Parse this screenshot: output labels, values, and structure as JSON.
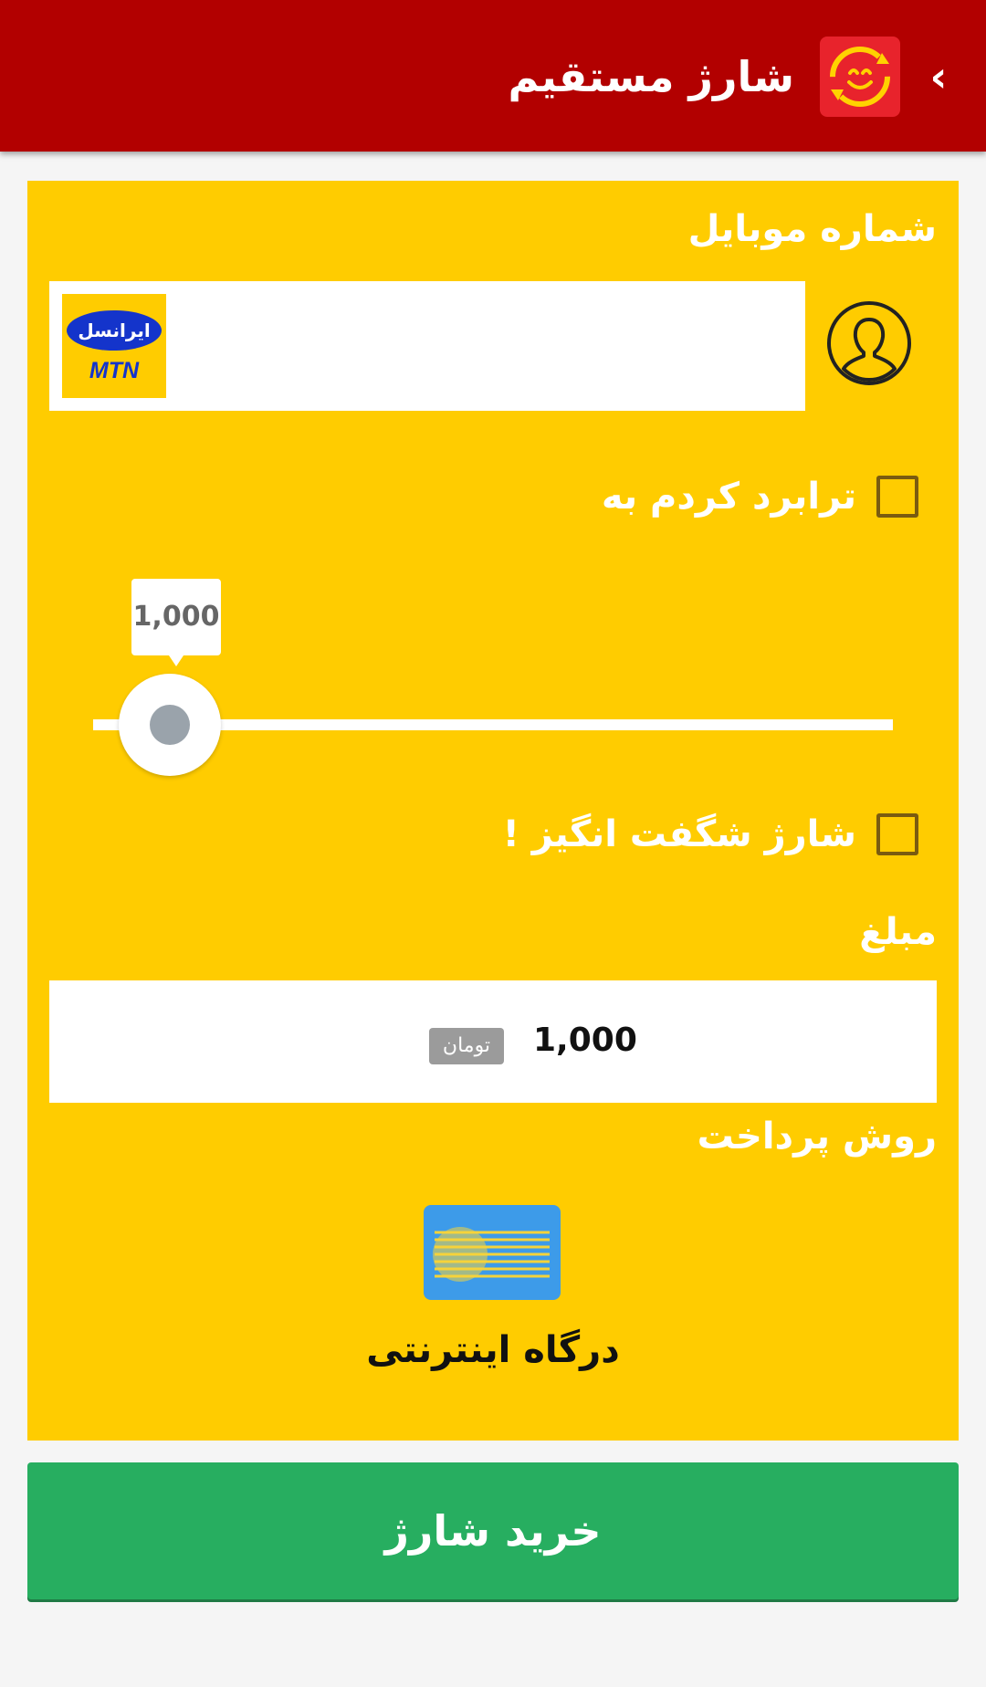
{
  "header": {
    "title": "شارژ مستقیم",
    "back_icon": "chevron-left-icon",
    "app_icon": "smiley-refresh-icon"
  },
  "form": {
    "mobile_label": "شماره موبایل",
    "operator_logo": {
      "text_fa": "ایرانسل",
      "text_en": "MTN"
    },
    "contact_icon": "contact-person-icon",
    "transfer_checkbox_label": "ترابرد کردم به",
    "transfer_checked": false,
    "slider": {
      "value": 1000,
      "display": "1,000"
    },
    "amazing_checkbox_label": "شارژ شگفت انگیز !",
    "amazing_checked": false,
    "amount_label": "مبلغ",
    "amount_value": "1,000",
    "currency": "تومان",
    "payment_method_label": "روش پرداخت",
    "payment_method": {
      "icon": "payment-gateway-icon",
      "label": "درگاه اینترنتی"
    }
  },
  "buy_button_label": "خرید شارژ",
  "colors": {
    "header": "#b20000",
    "card": "#ffcc00",
    "button": "#27ae60",
    "operator_blue": "#1434cb"
  }
}
